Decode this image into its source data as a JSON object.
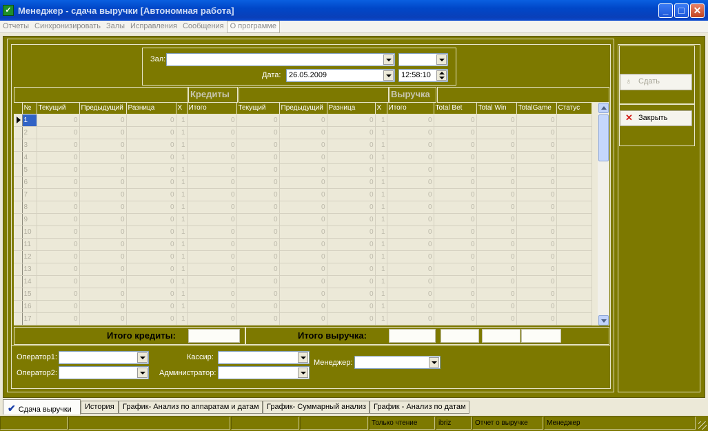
{
  "window": {
    "title": "Менеджер - сдача выручки [Автономная работа]",
    "minimize": "_",
    "maximize": "□",
    "close": "✕"
  },
  "menu": [
    "Отчеты",
    "Синхронизировать",
    "Залы",
    "Исправления",
    "Сообщения",
    "О программе"
  ],
  "filter": {
    "hall_label": "Зал:",
    "hall_value": "",
    "extra_value": "",
    "date_label": "Дата:",
    "date_value": "26.05.2009",
    "time_value": "12:58:10"
  },
  "group_headers": {
    "credits": "Кредиты",
    "revenue": "Выручка"
  },
  "grid": {
    "columns": [
      "№",
      "Текущий",
      "Предыдущий",
      "Разница",
      "X",
      "Итого",
      "Текущий",
      "Предыдущий",
      "Разница",
      "X",
      "Итого",
      "Total Bet",
      "Total Win",
      "TotalGame",
      "Статус"
    ],
    "rows": [
      [
        "1",
        "0",
        "0",
        "0",
        "1",
        "0",
        "0",
        "0",
        "0",
        "1",
        "0",
        "0",
        "0",
        "0",
        ""
      ],
      [
        "2",
        "0",
        "0",
        "0",
        "1",
        "0",
        "0",
        "0",
        "0",
        "1",
        "0",
        "0",
        "0",
        "0",
        ""
      ],
      [
        "3",
        "0",
        "0",
        "0",
        "1",
        "0",
        "0",
        "0",
        "0",
        "1",
        "0",
        "0",
        "0",
        "0",
        ""
      ],
      [
        "4",
        "0",
        "0",
        "0",
        "1",
        "0",
        "0",
        "0",
        "0",
        "1",
        "0",
        "0",
        "0",
        "0",
        ""
      ],
      [
        "5",
        "0",
        "0",
        "0",
        "1",
        "0",
        "0",
        "0",
        "0",
        "1",
        "0",
        "0",
        "0",
        "0",
        ""
      ],
      [
        "6",
        "0",
        "0",
        "0",
        "1",
        "0",
        "0",
        "0",
        "0",
        "1",
        "0",
        "0",
        "0",
        "0",
        ""
      ],
      [
        "7",
        "0",
        "0",
        "0",
        "1",
        "0",
        "0",
        "0",
        "0",
        "1",
        "0",
        "0",
        "0",
        "0",
        ""
      ],
      [
        "8",
        "0",
        "0",
        "0",
        "1",
        "0",
        "0",
        "0",
        "0",
        "1",
        "0",
        "0",
        "0",
        "0",
        ""
      ],
      [
        "9",
        "0",
        "0",
        "0",
        "1",
        "0",
        "0",
        "0",
        "0",
        "1",
        "0",
        "0",
        "0",
        "0",
        ""
      ],
      [
        "10",
        "0",
        "0",
        "0",
        "1",
        "0",
        "0",
        "0",
        "0",
        "1",
        "0",
        "0",
        "0",
        "0",
        ""
      ],
      [
        "11",
        "0",
        "0",
        "0",
        "1",
        "0",
        "0",
        "0",
        "0",
        "1",
        "0",
        "0",
        "0",
        "0",
        ""
      ],
      [
        "12",
        "0",
        "0",
        "0",
        "1",
        "0",
        "0",
        "0",
        "0",
        "1",
        "0",
        "0",
        "0",
        "0",
        ""
      ],
      [
        "13",
        "0",
        "0",
        "0",
        "1",
        "0",
        "0",
        "0",
        "0",
        "1",
        "0",
        "0",
        "0",
        "0",
        ""
      ],
      [
        "14",
        "0",
        "0",
        "0",
        "1",
        "0",
        "0",
        "0",
        "0",
        "1",
        "0",
        "0",
        "0",
        "0",
        ""
      ],
      [
        "15",
        "0",
        "0",
        "0",
        "1",
        "0",
        "0",
        "0",
        "0",
        "1",
        "0",
        "0",
        "0",
        "0",
        ""
      ],
      [
        "16",
        "0",
        "0",
        "0",
        "1",
        "0",
        "0",
        "0",
        "0",
        "1",
        "0",
        "0",
        "0",
        "0",
        ""
      ],
      [
        "17",
        "0",
        "0",
        "0",
        "1",
        "0",
        "0",
        "0",
        "0",
        "1",
        "0",
        "0",
        "0",
        "0",
        ""
      ]
    ]
  },
  "totals": {
    "credits_label": "Итого кредиты:",
    "revenue_label": "Итого выручка:"
  },
  "staff": {
    "operator1_label": "Оператор1:",
    "operator2_label": "Оператор2:",
    "cashier_label": "Кассир:",
    "admin_label": "Администратор:",
    "manager_label": "Менеджер:"
  },
  "buttons": {
    "submit": "Сдать",
    "close": "Закрыть"
  },
  "tabs": [
    "Сдача выручки",
    "История",
    "График- Анализ по аппаратам и датам",
    "График- Суммарный анализ",
    "График - Анализ по датам"
  ],
  "status": [
    "",
    "",
    "",
    "",
    "Только чтение",
    "ibriz",
    "Отчет о выручке",
    "Менеджер"
  ]
}
